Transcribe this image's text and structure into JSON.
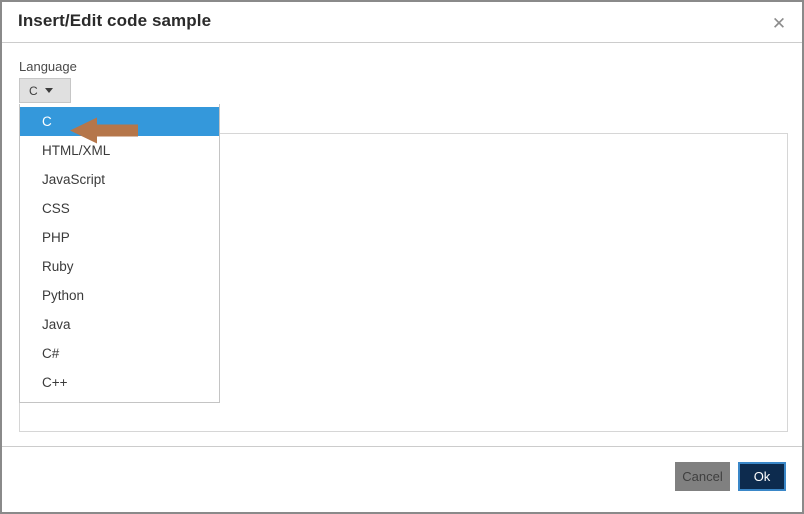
{
  "dialog": {
    "title": "Insert/Edit code sample",
    "close_icon": "close-icon",
    "close_glyph": "✕"
  },
  "form": {
    "language_label": "Language",
    "language_selected": "C",
    "caret_icon": "chevron-down-icon",
    "dropdown_open": true,
    "dropdown_options": [
      "C",
      "HTML/XML",
      "JavaScript",
      "CSS",
      "PHP",
      "Ruby",
      "Python",
      "Java",
      "C#",
      "C++"
    ],
    "code_value": "",
    "code_placeholder": ""
  },
  "footer": {
    "cancel_label": "Cancel",
    "ok_label": "Ok"
  },
  "annotation": {
    "arrow_icon": "left-arrow-annotation",
    "arrow_color": "#b5764a",
    "points_to": "language-select-button"
  },
  "colors": {
    "highlight": "#3498db",
    "ok_button": "#0d2b4e",
    "ok_border": "#3a87c8",
    "cancel_button": "#808080",
    "window_border": "#8a8a8a",
    "select_button": "#e0e0e0"
  }
}
